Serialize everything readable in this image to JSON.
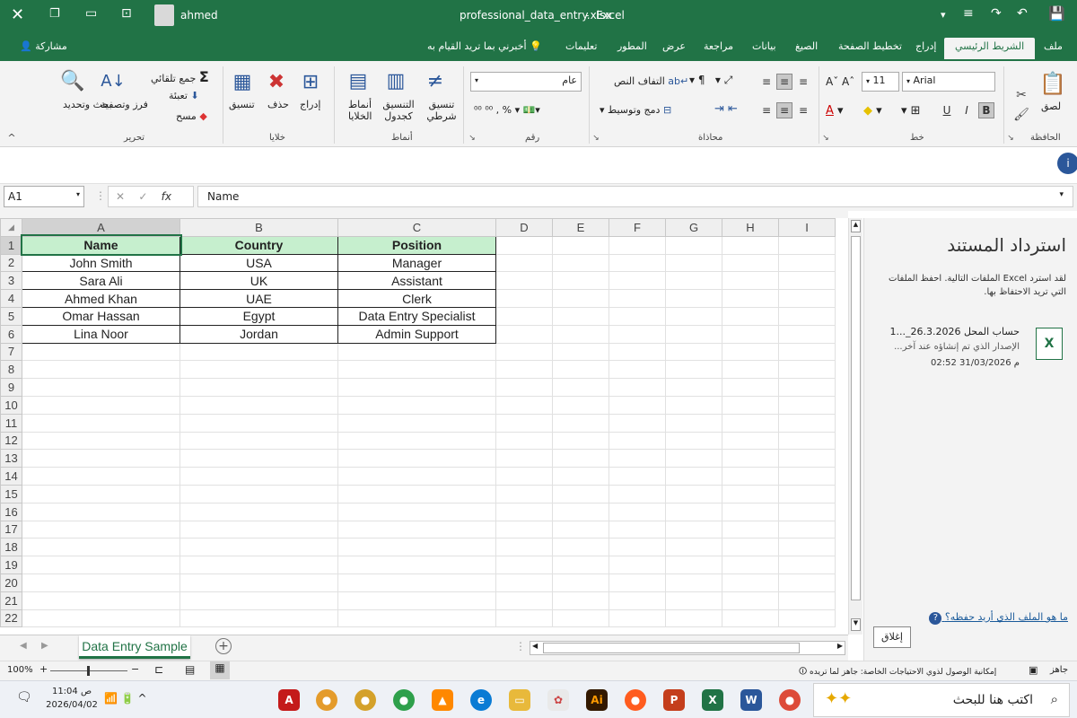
{
  "titlebar": {
    "filename": "professional_data_entry.xlsx",
    "app": "Excel",
    "user": "ahmed"
  },
  "tabs": [
    "ملف",
    "الشريط الرئيسي",
    "إدراج",
    "تخطيط الصفحة",
    "الصيغ",
    "بيانات",
    "مراجعة",
    "عرض",
    "المطور",
    "تعليمات"
  ],
  "tell_me": "أخبرني بما تريد القيام به",
  "share": "مشاركة",
  "ribbon": {
    "paste": "لصق",
    "clipboard": "الحافظة",
    "font_name": "Arial",
    "font_size": "11",
    "font_group": "خط",
    "wrap_text": "التفاف النص",
    "merge_center": "دمج وتوسيط",
    "alignment_group": "محاذاة",
    "number_format": "عام",
    "number_group": "رقم",
    "conditional_fmt": "تنسيق شرطي",
    "format_table": "التنسيق كجدول",
    "cell_styles": "أنماط الخلايا",
    "styles_group": "أنماط",
    "insert": "إدراج",
    "delete": "حذف",
    "format": "تنسيق",
    "cells_group": "خلايا",
    "autosum": "جمع تلقائي",
    "fill": "تعبئة",
    "clear": "مسح",
    "sort_filter": "فرز وتصفية",
    "find_select": "بحث وتحديد",
    "editing_group": "تحرير"
  },
  "formula_bar": {
    "name_box": "A1",
    "fx": "fx",
    "content": "Name"
  },
  "columns": [
    "A",
    "B",
    "C",
    "D",
    "E",
    "F",
    "G",
    "H",
    "I"
  ],
  "rows": [
    "1",
    "2",
    "3",
    "4",
    "5",
    "6",
    "7",
    "8",
    "9",
    "10",
    "11",
    "12",
    "13",
    "14",
    "15",
    "16",
    "17",
    "18",
    "19",
    "20",
    "21",
    "22"
  ],
  "table": {
    "headers": [
      "Name",
      "Country",
      "Position"
    ],
    "data": [
      [
        "John Smith",
        "USA",
        "Manager"
      ],
      [
        "Sara Ali",
        "UK",
        "Assistant"
      ],
      [
        "Ahmed Khan",
        "UAE",
        "Clerk"
      ],
      [
        "Omar Hassan",
        "Egypt",
        "Data Entry Specialist"
      ],
      [
        "Lina Noor",
        "Jordan",
        "Admin Support"
      ]
    ]
  },
  "recovery": {
    "title": "استرداد المستند",
    "desc": "لقد استرد Excel الملفات التالية. احفظ الملفات التي تريد الاحتفاظ بها.",
    "file_name": "حساب المحل 26.3.2026_...1",
    "file_note": "الإصدار الذي تم إنشاؤه عند آخر...",
    "file_time": "02:52 31/03/2026 م",
    "help_link": "ما هو الملف الذي أريد حفظه؟",
    "close_btn": "إغلاق"
  },
  "sheet_tab": "Data Entry Sample",
  "status": {
    "ready": "جاهز",
    "accessibility": "إمكانية الوصول لذوي الاحتياجات الخاصة: جاهز لما تريده",
    "zoom": "100%"
  },
  "taskbar": {
    "search": "اكتب هنا للبحث",
    "time": "11:04 ص",
    "date": "2026/04/02"
  },
  "colors": {
    "excel_green": "#217346",
    "header_fill": "#c6efce"
  }
}
